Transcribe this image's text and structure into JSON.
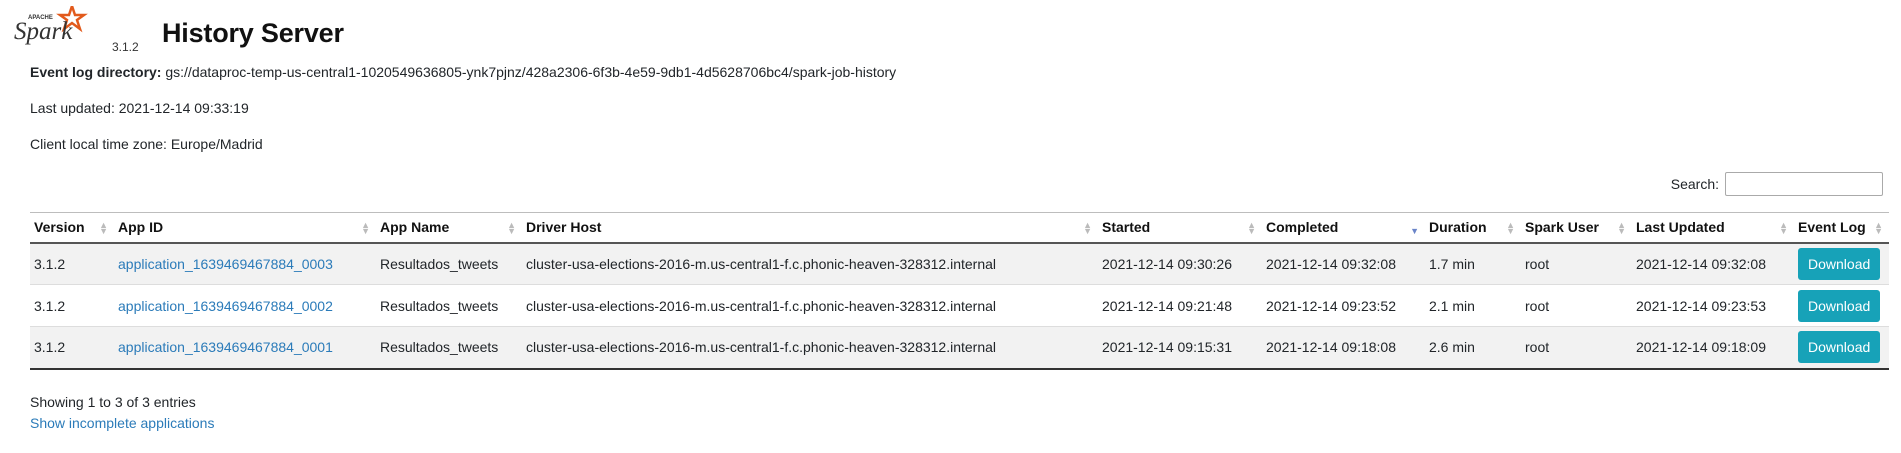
{
  "header": {
    "logo_apache": "APACHE",
    "logo_text": "Spark",
    "version": "3.1.2",
    "title": "History Server"
  },
  "info": {
    "event_log_label": "Event log directory:",
    "event_log_value": "gs://dataproc-temp-us-central1-1020549636805-ynk7pjnz/428a2306-6f3b-4e59-9db1-4d5628706bc4/spark-job-history",
    "last_updated": "Last updated: 2021-12-14 09:33:19",
    "timezone": "Client local time zone: Europe/Madrid"
  },
  "search": {
    "label": "Search:",
    "value": ""
  },
  "table": {
    "columns": [
      "Version",
      "App ID",
      "App Name",
      "Driver Host",
      "Started",
      "Completed",
      "Duration",
      "Spark User",
      "Last Updated",
      "Event Log"
    ],
    "sorted_column": "Completed",
    "rows": [
      {
        "version": "3.1.2",
        "app_id": "application_1639469467884_0003",
        "app_name": "Resultados_tweets",
        "driver_host": "cluster-usa-elections-2016-m.us-central1-f.c.phonic-heaven-328312.internal",
        "started": "2021-12-14 09:30:26",
        "completed": "2021-12-14 09:32:08",
        "duration": "1.7 min",
        "spark_user": "root",
        "last_updated": "2021-12-14 09:32:08",
        "event_log": "Download"
      },
      {
        "version": "3.1.2",
        "app_id": "application_1639469467884_0002",
        "app_name": "Resultados_tweets",
        "driver_host": "cluster-usa-elections-2016-m.us-central1-f.c.phonic-heaven-328312.internal",
        "started": "2021-12-14 09:21:48",
        "completed": "2021-12-14 09:23:52",
        "duration": "2.1 min",
        "spark_user": "root",
        "last_updated": "2021-12-14 09:23:53",
        "event_log": "Download"
      },
      {
        "version": "3.1.2",
        "app_id": "application_1639469467884_0001",
        "app_name": "Resultados_tweets",
        "driver_host": "cluster-usa-elections-2016-m.us-central1-f.c.phonic-heaven-328312.internal",
        "started": "2021-12-14 09:15:31",
        "completed": "2021-12-14 09:18:08",
        "duration": "2.6 min",
        "spark_user": "root",
        "last_updated": "2021-12-14 09:18:09",
        "event_log": "Download"
      }
    ]
  },
  "footer": {
    "showing": "Showing 1 to 3 of 3 entries",
    "incomplete_link": "Show incomplete applications"
  },
  "colors": {
    "link": "#2b7bb9",
    "button": "#17a2b8",
    "logo_orange": "#e25a1c"
  }
}
